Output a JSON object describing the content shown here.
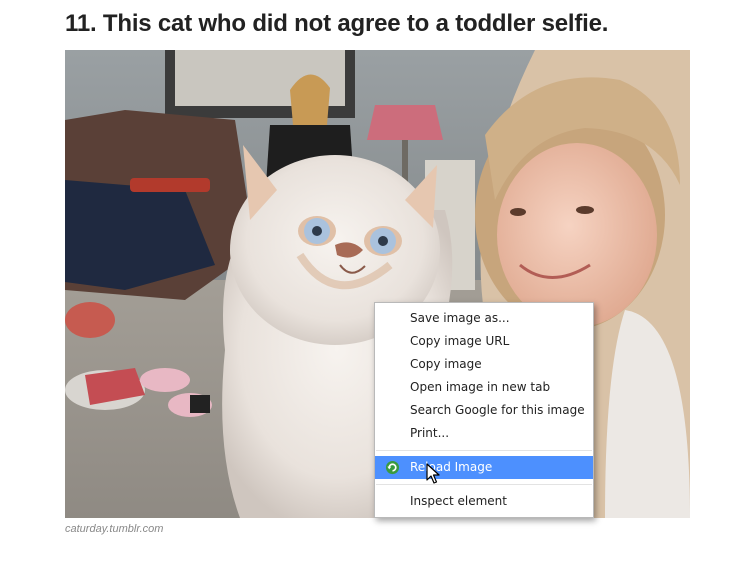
{
  "article": {
    "heading": "11. This cat who did not agree to a toddler selfie.",
    "photo_credit": "caturday.tumblr.com"
  },
  "context_menu": {
    "items": [
      {
        "label": "Save image as..."
      },
      {
        "label": "Copy image URL"
      },
      {
        "label": "Copy image"
      },
      {
        "label": "Open image in new tab"
      },
      {
        "label": "Search Google for this image"
      },
      {
        "label": "Print..."
      },
      {
        "label": "Reload Image",
        "icon": "reload-icon",
        "highlighted": true
      },
      {
        "label": "Inspect element"
      }
    ],
    "highlight_color": "#4d90fe"
  }
}
